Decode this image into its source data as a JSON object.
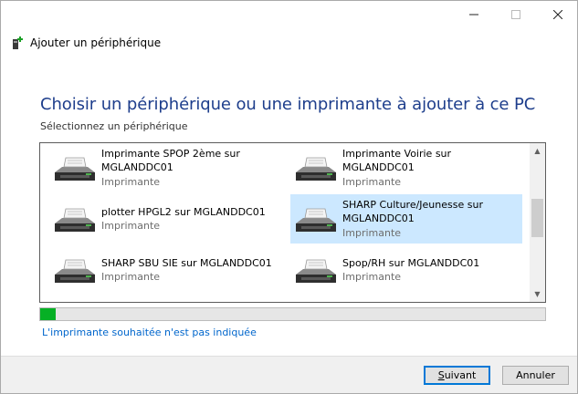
{
  "dialog": {
    "title": "Ajouter un périphérique",
    "heading": "Choisir un périphérique ou une imprimante à ajouter à ce PC",
    "subheading": "Sélectionnez un périphérique"
  },
  "devices": [
    {
      "name_line1": "Imprimante SPOP 2ème sur",
      "name_line2": "MGLANDDC01",
      "type": "Imprimante",
      "selected": false
    },
    {
      "name_line1": "Imprimante Voirie sur MGLANDDC01",
      "name_line2": "",
      "type": "Imprimante",
      "selected": false
    },
    {
      "name_line1": "plotter HPGL2 sur MGLANDDC01",
      "name_line2": "",
      "type": "Imprimante",
      "selected": false
    },
    {
      "name_line1": "SHARP Culture/Jeunesse sur",
      "name_line2": "MGLANDDC01",
      "type": "Imprimante",
      "selected": true
    },
    {
      "name_line1": "SHARP SBU SIE sur MGLANDDC01",
      "name_line2": "",
      "type": "Imprimante",
      "selected": false
    },
    {
      "name_line1": "Spop/RH sur MGLANDDC01",
      "name_line2": "",
      "type": "Imprimante",
      "selected": false
    }
  ],
  "progress": {
    "value_percent": 3
  },
  "link_text": "L'imprimante souhaitée n'est pas indiquée",
  "buttons": {
    "next_underlined": "S",
    "next_rest": "uivant",
    "cancel": "Annuler"
  },
  "icons": {
    "window_icon": "add-device-icon",
    "device_icon": "printer-icon"
  },
  "colors": {
    "heading": "#1e3e8c",
    "selection": "#cce8ff",
    "progress": "#06b025",
    "link": "#0066cc",
    "primary_border": "#0078d7"
  }
}
